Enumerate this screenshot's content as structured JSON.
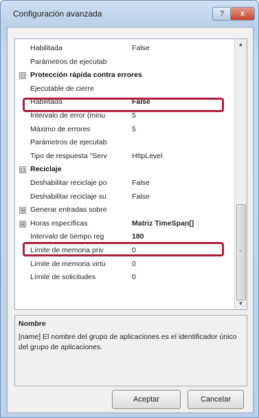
{
  "window": {
    "title": "Configuración avanzada",
    "help_glyph": "?",
    "close_glyph": "x"
  },
  "grid": {
    "rows": [
      {
        "name": "Habilitada",
        "value": "False"
      },
      {
        "name": "Parámetros de ejecutab",
        "value": ""
      },
      {
        "name": "Protección rápida contra errores",
        "value": "",
        "category": true,
        "expander": "⊟"
      },
      {
        "name": "Ejecutable de cierre",
        "value": ""
      },
      {
        "name": "Habilitada",
        "value": "False",
        "bold": true
      },
      {
        "name": "Intervalo de error (minu",
        "value": "5"
      },
      {
        "name": "Máximo de errores",
        "value": "5"
      },
      {
        "name": "Parámetros de ejecutab",
        "value": ""
      },
      {
        "name": "Tipo de respuesta \"Serv",
        "value": "HttpLevel"
      },
      {
        "name": "Reciclaje",
        "value": "",
        "category": true,
        "expander": "⊟"
      },
      {
        "name": "Deshabilitar reciclaje po",
        "value": "False"
      },
      {
        "name": "Deshabilitar reciclaje su",
        "value": "False"
      },
      {
        "name": "Generar entradas sobre",
        "value": "",
        "expander": "⊞"
      },
      {
        "name": "Horas específicas",
        "value": "Matriz TimeSpan[]",
        "bold": true,
        "expander": "⊞"
      },
      {
        "name": "Intervalo de tiempo reg",
        "value": "180",
        "bold": true
      },
      {
        "name": "Límite de memoria priv",
        "value": "0"
      },
      {
        "name": "Límite de memoria virtu",
        "value": "0"
      },
      {
        "name": "Límite de solicitudes",
        "value": "0"
      }
    ],
    "scroll_up": "▲",
    "scroll_down": "▼",
    "scroll_grip": "≡"
  },
  "description": {
    "title": "Nombre",
    "text": "[name] El nombre del grupo de aplicaciones es el identificador único del grupo de aplicaciones."
  },
  "buttons": {
    "ok": "Aceptar",
    "cancel": "Cancelar"
  },
  "colors": {
    "highlight": "#b01c3a"
  }
}
